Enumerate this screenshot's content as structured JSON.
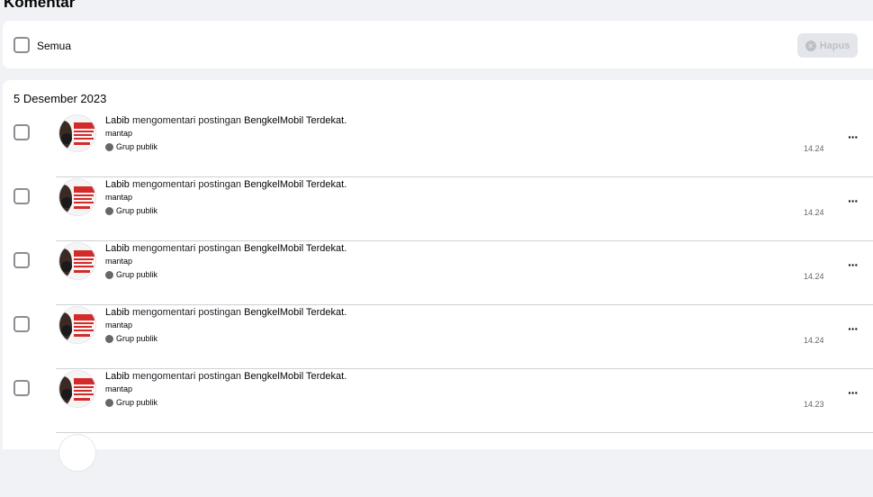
{
  "page": {
    "heading": "Komentar"
  },
  "toolbar": {
    "select_all_label": "Semua",
    "delete_label": "Hapus"
  },
  "list": {
    "date": "5 Desember 2023",
    "rows": [
      {
        "actor": "Labib",
        "verb": " mengomentari postingan ",
        "target": "BengkelMobil Terdekat.",
        "comment": "mantap",
        "audience": "Grup publik",
        "time": "14.24"
      },
      {
        "actor": "Labib",
        "verb": " mengomentari postingan ",
        "target": "BengkelMobil Terdekat.",
        "comment": "mantap",
        "audience": "Grup publik",
        "time": "14.24"
      },
      {
        "actor": "Labib",
        "verb": " mengomentari postingan ",
        "target": "BengkelMobil Terdekat.",
        "comment": "mantap",
        "audience": "Grup publik",
        "time": "14.24"
      },
      {
        "actor": "Labib",
        "verb": " mengomentari postingan ",
        "target": "BengkelMobil Terdekat.",
        "comment": "mantap",
        "audience": "Grup publik",
        "time": "14.24"
      },
      {
        "actor": "Labib",
        "verb": " mengomentari postingan ",
        "target": "BengkelMobil Terdekat.",
        "comment": "mantap",
        "audience": "Grup publik",
        "time": "14.23"
      }
    ]
  },
  "colors": {
    "accent_red": "#d42a2a",
    "text": "#050505",
    "muted": "#65676b",
    "divider": "#ced0d4"
  }
}
